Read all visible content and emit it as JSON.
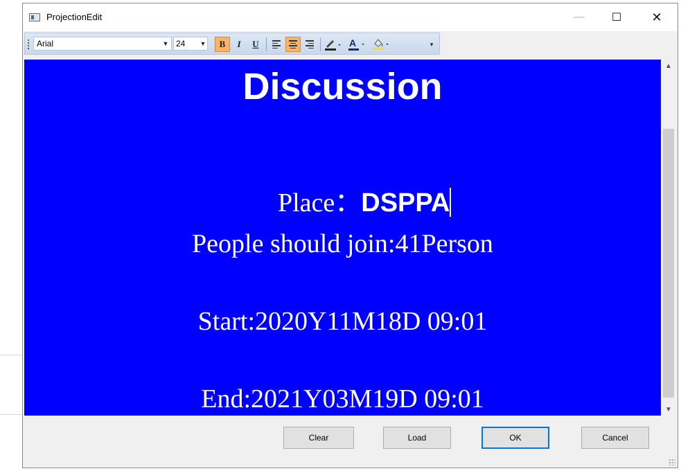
{
  "window": {
    "title": "ProjectionEdit",
    "controls": {
      "minimize": "—",
      "maximize": "☐",
      "close": "✕"
    }
  },
  "toolbar": {
    "font_family": "Arial",
    "font_size": "24",
    "bold": "B",
    "italic": "I",
    "underline": "U",
    "font_color_glyph": "A",
    "active_buttons": [
      "bold",
      "align-center"
    ],
    "highlight_color": "#f7b46a",
    "icons": [
      "bold-icon",
      "italic-icon",
      "underline-icon",
      "align-left-icon",
      "align-center-icon",
      "align-right-icon",
      "pen-color-icon",
      "font-color-icon",
      "fill-color-icon",
      "overflow-chevron-icon"
    ]
  },
  "editor": {
    "background_color": "#0000fe",
    "text_color": "#ffffff",
    "heading": "Discussion",
    "place_label": "Place：",
    "place_value": "DSPPA",
    "people_line": "People should join:41Person",
    "start_line": "Start:2020Y11M18D 09:01",
    "end_line": "End:2021Y03M19D 09:01"
  },
  "buttons": {
    "clear": "Clear",
    "load": "Load",
    "ok": "OK",
    "cancel": "Cancel"
  }
}
